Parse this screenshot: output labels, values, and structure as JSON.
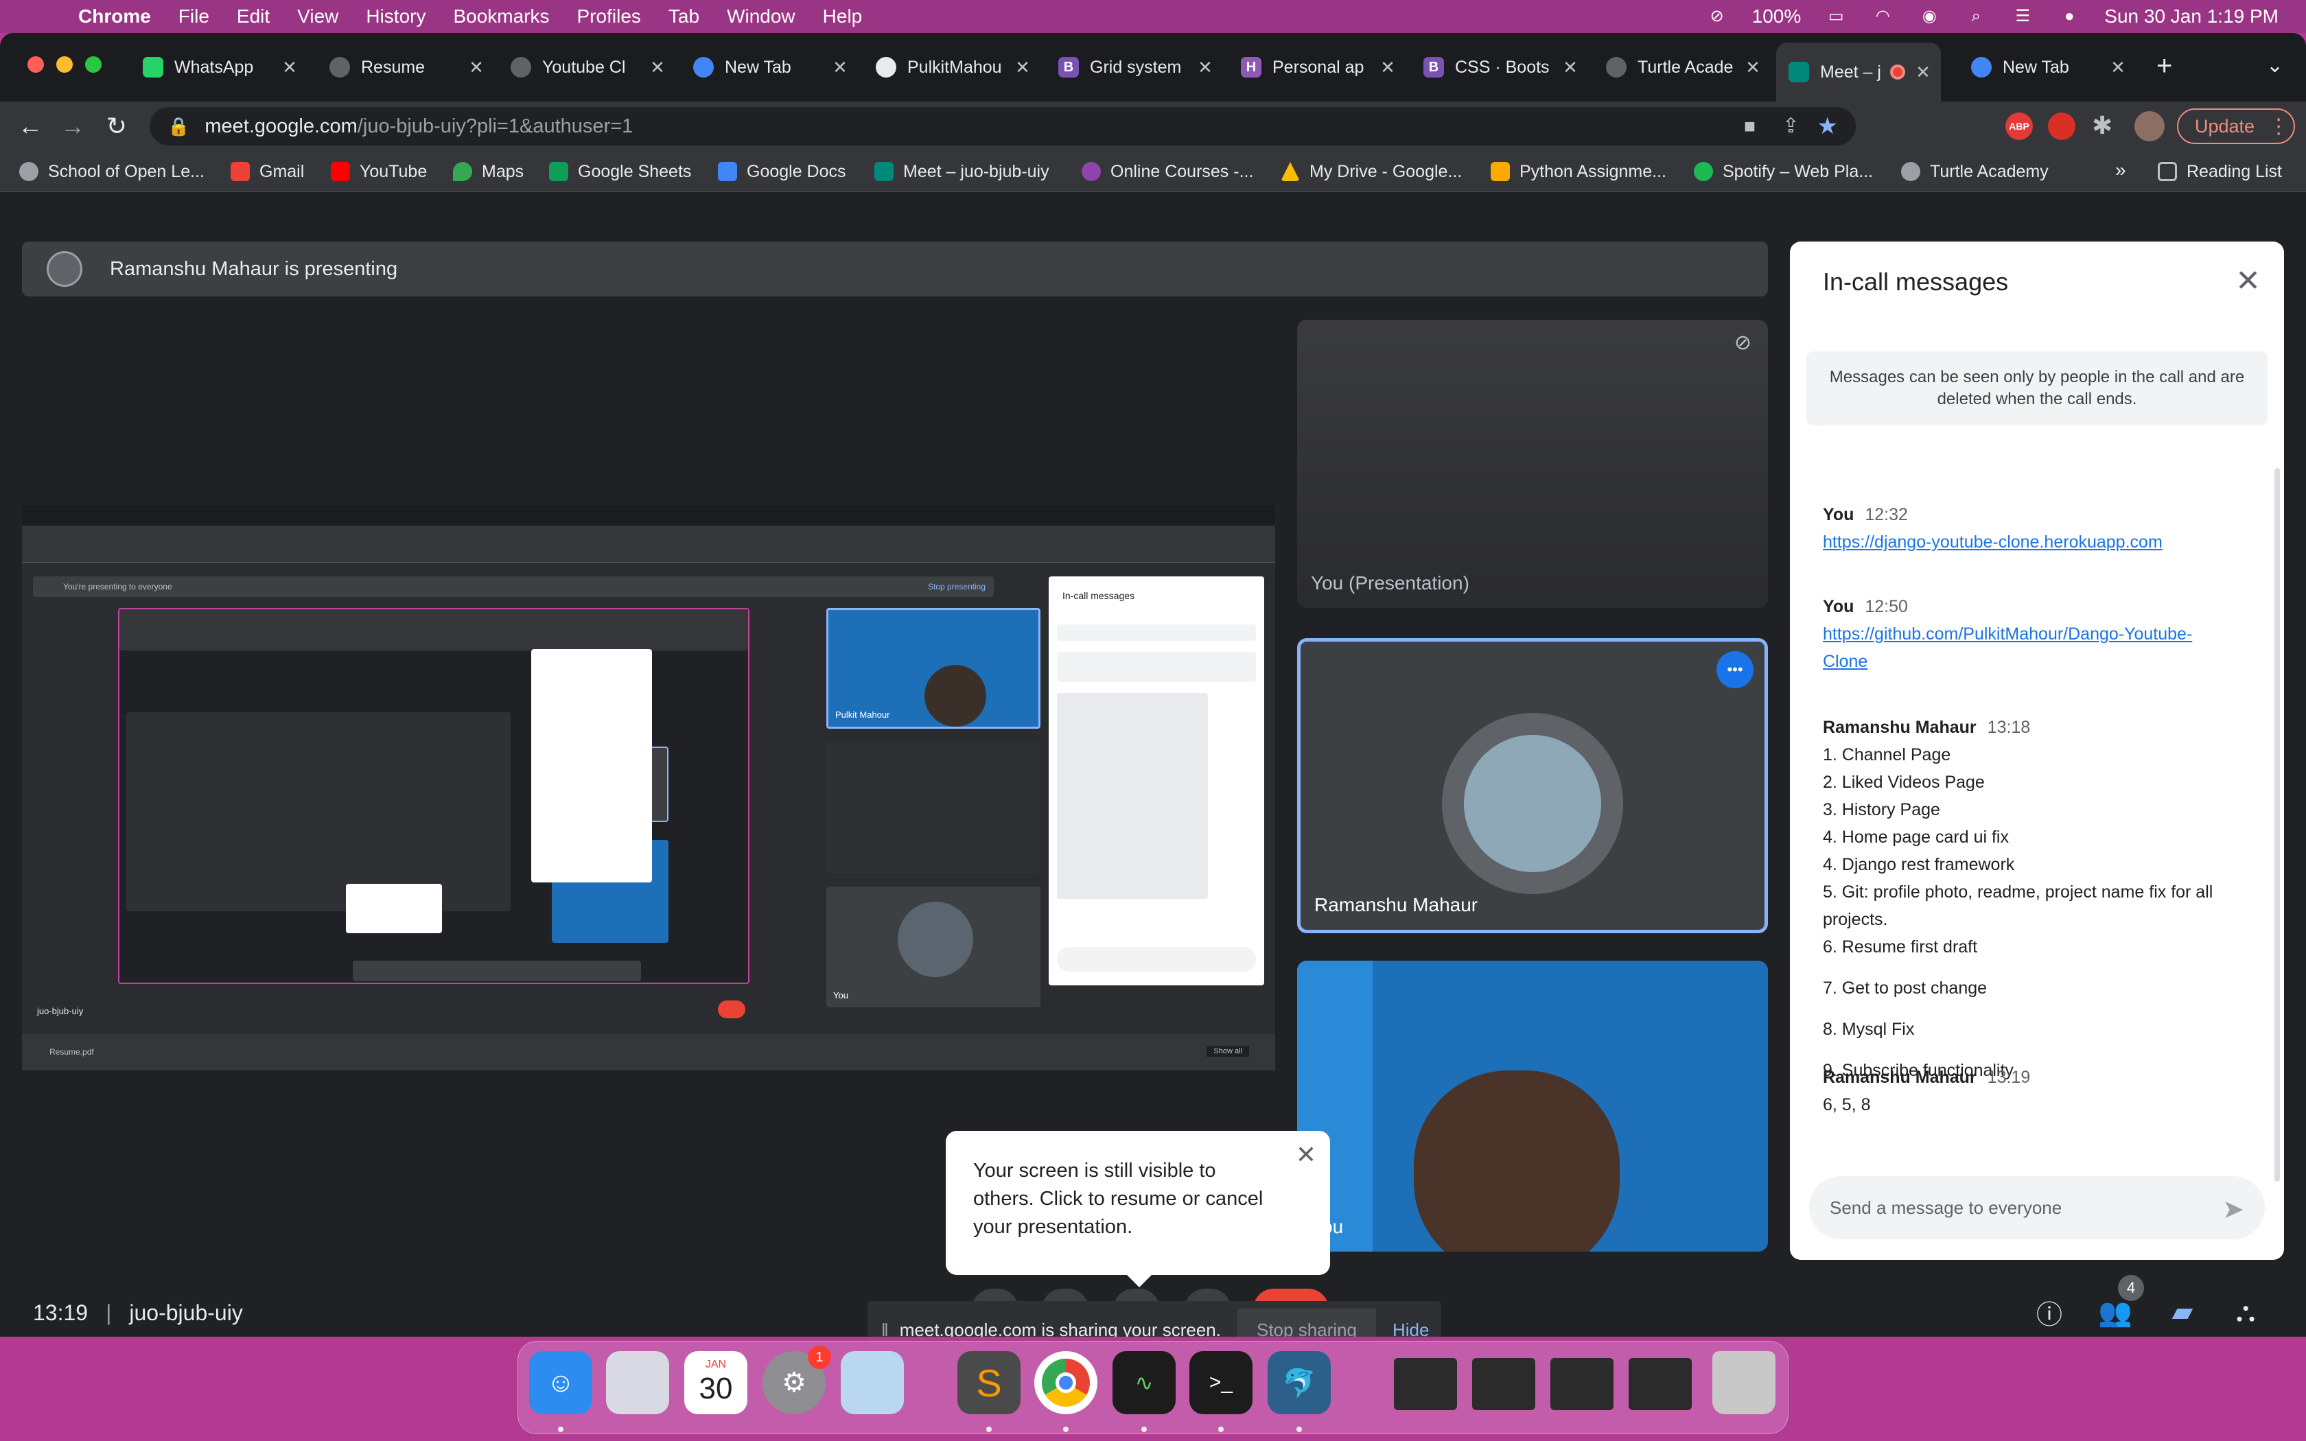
{
  "menubar": {
    "app": "Chrome",
    "items": [
      "File",
      "Edit",
      "View",
      "History",
      "Bookmarks",
      "Profiles",
      "Tab",
      "Window",
      "Help"
    ],
    "battery": "100%",
    "datetime": "Sun 30 Jan  1:19 PM"
  },
  "tabs": [
    {
      "title": "WhatsApp",
      "color": "#25d366"
    },
    {
      "title": "Resume",
      "color": "#5f6368"
    },
    {
      "title": "Youtube Clo",
      "color": "#5f6368"
    },
    {
      "title": "New Tab",
      "color": "#4285f4"
    },
    {
      "title": "PulkitMahou",
      "color": "#e8eaed"
    },
    {
      "title": "Grid system",
      "color": "#7952b3"
    },
    {
      "title": "Personal ap",
      "color": "#8e5ab5"
    },
    {
      "title": "CSS · Boots",
      "color": "#7952b3"
    },
    {
      "title": "Turtle Acade",
      "color": "#5f6368"
    },
    {
      "title": "Meet – j",
      "color": "#00897b"
    },
    {
      "title": "New Tab",
      "color": "#4285f4"
    }
  ],
  "address": {
    "host": "meet.google.com",
    "path": "/juo-bjub-uiy?pli=1&authuser=1",
    "update_label": "Update"
  },
  "bookmarks": [
    {
      "label": "School of Open Le...",
      "color": "#9aa0a6"
    },
    {
      "label": "Gmail",
      "color": "#ea4335"
    },
    {
      "label": "YouTube",
      "color": "#ff0000"
    },
    {
      "label": "Maps",
      "color": "#34a853"
    },
    {
      "label": "Google Sheets",
      "color": "#0f9d58"
    },
    {
      "label": "Google Docs",
      "color": "#4285f4"
    },
    {
      "label": "Meet – juo-bjub-uiy",
      "color": "#00897b"
    },
    {
      "label": "Online Courses -...",
      "color": "#8e44ad"
    },
    {
      "label": "My Drive - Google...",
      "color": "#fbbc04"
    },
    {
      "label": "Python Assignme...",
      "color": "#f9ab00"
    },
    {
      "label": "Spotify – Web Pla...",
      "color": "#1db954"
    },
    {
      "label": "Turtle Academy",
      "color": "#9aa0a6"
    }
  ],
  "reading_list": "Reading List",
  "presenting_banner": "Ramanshu Mahaur is presenting",
  "tiles": {
    "presentation_label": "You (Presentation)",
    "ramanshu": "Ramanshu Mahaur",
    "you": "You"
  },
  "chat": {
    "title": "In-call messages",
    "notice": "Messages can be seen only by people in the call and are deleted when the call ends.",
    "messages": [
      {
        "sender": "You",
        "time": "12:32",
        "link": "https://django-youtube-clone.herokuapp.com"
      },
      {
        "sender": "You",
        "time": "12:50",
        "link": "https://github.com/PulkitMahour/Dango-Youtube-Clone"
      },
      {
        "sender": "Ramanshu Mahaur",
        "time": "13:18",
        "lines": [
          "1. Channel Page",
          "2. Liked Videos Page",
          "3. History Page",
          "4. Home page card ui fix",
          "4. Django rest framework",
          "5. Git: profile photo, readme, project name fix for all projects.",
          "6. Resume first draft",
          "7. Get to post change",
          "8. Mysql Fix",
          "9. Subscribe functionality"
        ]
      },
      {
        "sender": "Ramanshu Mahaur",
        "time": "13:19",
        "lines": [
          "6, 5, 8"
        ]
      }
    ],
    "input_placeholder": "Send a message to everyone"
  },
  "meeting": {
    "time": "13:19",
    "code": "juo-bjub-uiy",
    "participant_count": "4"
  },
  "tooltip": "Your screen is still visible to others. Click to resume or cancel your presentation.",
  "sharebar": {
    "text": "meet.google.com is sharing your screen.",
    "stop": "Stop sharing",
    "hide": "Hide"
  },
  "dock": {
    "calendar_month": "JAN",
    "calendar_day": "30",
    "settings_badge": "1"
  },
  "nested_screen": {
    "banner": "You're presenting to everyone",
    "stop": "Stop presenting",
    "chat_title": "In-call messages",
    "tile_name": "Pulkit Mahour",
    "you_label": "You",
    "code": "juo-bjub-uiy",
    "download": "Resume.pdf",
    "show_all": "Show all"
  }
}
